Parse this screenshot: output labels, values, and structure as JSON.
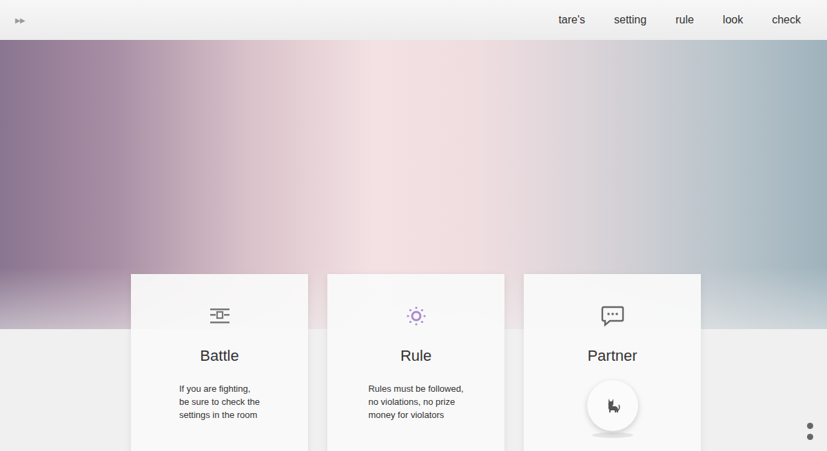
{
  "nav": {
    "brand_icon": "▶▶",
    "links": [
      {
        "label": "tare's"
      },
      {
        "label": "setting"
      },
      {
        "label": "rule"
      },
      {
        "label": "look"
      },
      {
        "label": "check"
      }
    ]
  },
  "cards": [
    {
      "title": "Battle",
      "kind": "text",
      "lines": [
        "If you are fighting,",
        "be sure to check the",
        "settings in the room"
      ]
    },
    {
      "title": "Rule",
      "kind": "text",
      "lines": [
        "Rules must be followed,",
        "no violations, no prize",
        "money for violators"
      ]
    },
    {
      "title": "Partner",
      "kind": "button",
      "lines": []
    }
  ]
}
